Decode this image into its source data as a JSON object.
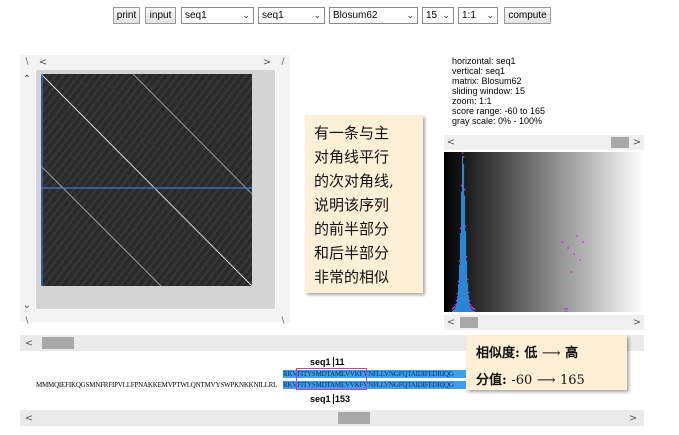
{
  "toolbar": {
    "print_label": "print",
    "input_label": "input",
    "horizontal_seq": "seq1",
    "vertical_seq": "seq1",
    "matrix": "Blosum62",
    "window": "15",
    "zoom": "1:1",
    "compute_label": "compute"
  },
  "info": {
    "horizontal": "horizontal: seq1",
    "vertical": "vertical: seq1",
    "matrix": "matrix: Blosum62",
    "window": "sliding window: 15",
    "zoom": "zoom: 1:1",
    "score_range": "score range: -60 to 165",
    "gray_scale": "gray scale: 0% - 100%"
  },
  "annotation_main": {
    "lines": [
      "有一条与主",
      "对角线平行",
      "的次对角线,",
      "说明该序列",
      "的前半部分",
      "和后半部分",
      "非常的相似"
    ]
  },
  "annotation_legend": {
    "line1_label": "相似度:",
    "line1_low": "低",
    "line1_high": "高",
    "line2_label": "分值:",
    "line2_low": "-60",
    "line2_high": "165"
  },
  "alignment": {
    "top_label_name": "seq1",
    "top_label_pos": "11",
    "bottom_label_name": "seq1",
    "bottom_label_pos": "153",
    "top_seq_visible": "RKVFITYSMDTAMEVVKFVNFLLVNGFQTAIDIFEDRIQG",
    "bottom_seq_left": "MMMQIEFIKQGSMNFRFIPVLLFPNAKKEMVPTWLQNTMVYSWPKNKKNILLRL",
    "bottom_seq_right": "RKVFITYSMDTAMEVVKFVNFLLVNGFQTAIDIFEDRIQG"
  },
  "colors": {
    "highlight": "#3da0ef",
    "window_box": "#c040c0",
    "crosshair": "#3a78d8",
    "note_bg": "#fdf0d6"
  },
  "histogram": {
    "note": "",
    "bins": [
      0,
      0,
      0,
      0,
      0,
      0,
      0,
      0,
      1,
      2,
      3,
      5,
      9,
      16,
      28,
      48,
      80,
      122,
      158,
      150,
      118,
      82,
      52,
      30,
      17,
      9,
      5,
      3,
      2,
      1,
      1,
      0,
      0,
      0,
      0,
      0,
      0,
      0,
      0,
      0,
      0,
      0,
      0,
      0,
      0,
      0,
      0,
      0,
      0,
      0,
      0,
      0,
      0,
      0,
      0,
      0,
      0,
      0,
      0,
      0,
      0,
      0,
      0,
      0,
      0,
      0,
      0,
      0,
      0,
      0,
      0,
      0,
      0,
      0,
      0,
      0,
      0,
      0,
      0,
      0,
      0,
      0,
      0,
      0,
      0,
      0,
      0,
      0,
      0,
      0,
      0,
      0,
      0,
      0,
      0,
      0,
      0,
      0,
      0,
      0,
      0,
      0,
      0,
      0,
      0,
      0,
      0,
      0,
      0,
      0,
      0,
      0,
      0,
      0,
      0,
      0,
      0,
      0,
      0,
      0,
      1,
      1,
      1,
      0,
      0,
      0,
      0,
      0,
      0,
      0,
      0,
      0,
      0,
      0,
      0,
      0,
      0,
      0,
      0,
      0,
      0,
      0,
      0,
      0,
      0,
      0,
      0,
      0,
      0,
      0,
      0,
      0,
      0,
      0,
      0,
      0,
      0,
      0,
      0,
      0,
      0,
      0,
      0,
      0,
      0,
      0,
      0,
      0,
      0,
      0,
      0,
      0,
      0,
      0,
      0,
      0,
      0,
      0,
      0,
      0,
      0,
      0,
      0,
      0,
      0,
      0,
      0,
      0,
      0,
      0,
      0,
      0,
      0,
      0,
      0,
      0,
      0,
      0,
      0
    ]
  }
}
